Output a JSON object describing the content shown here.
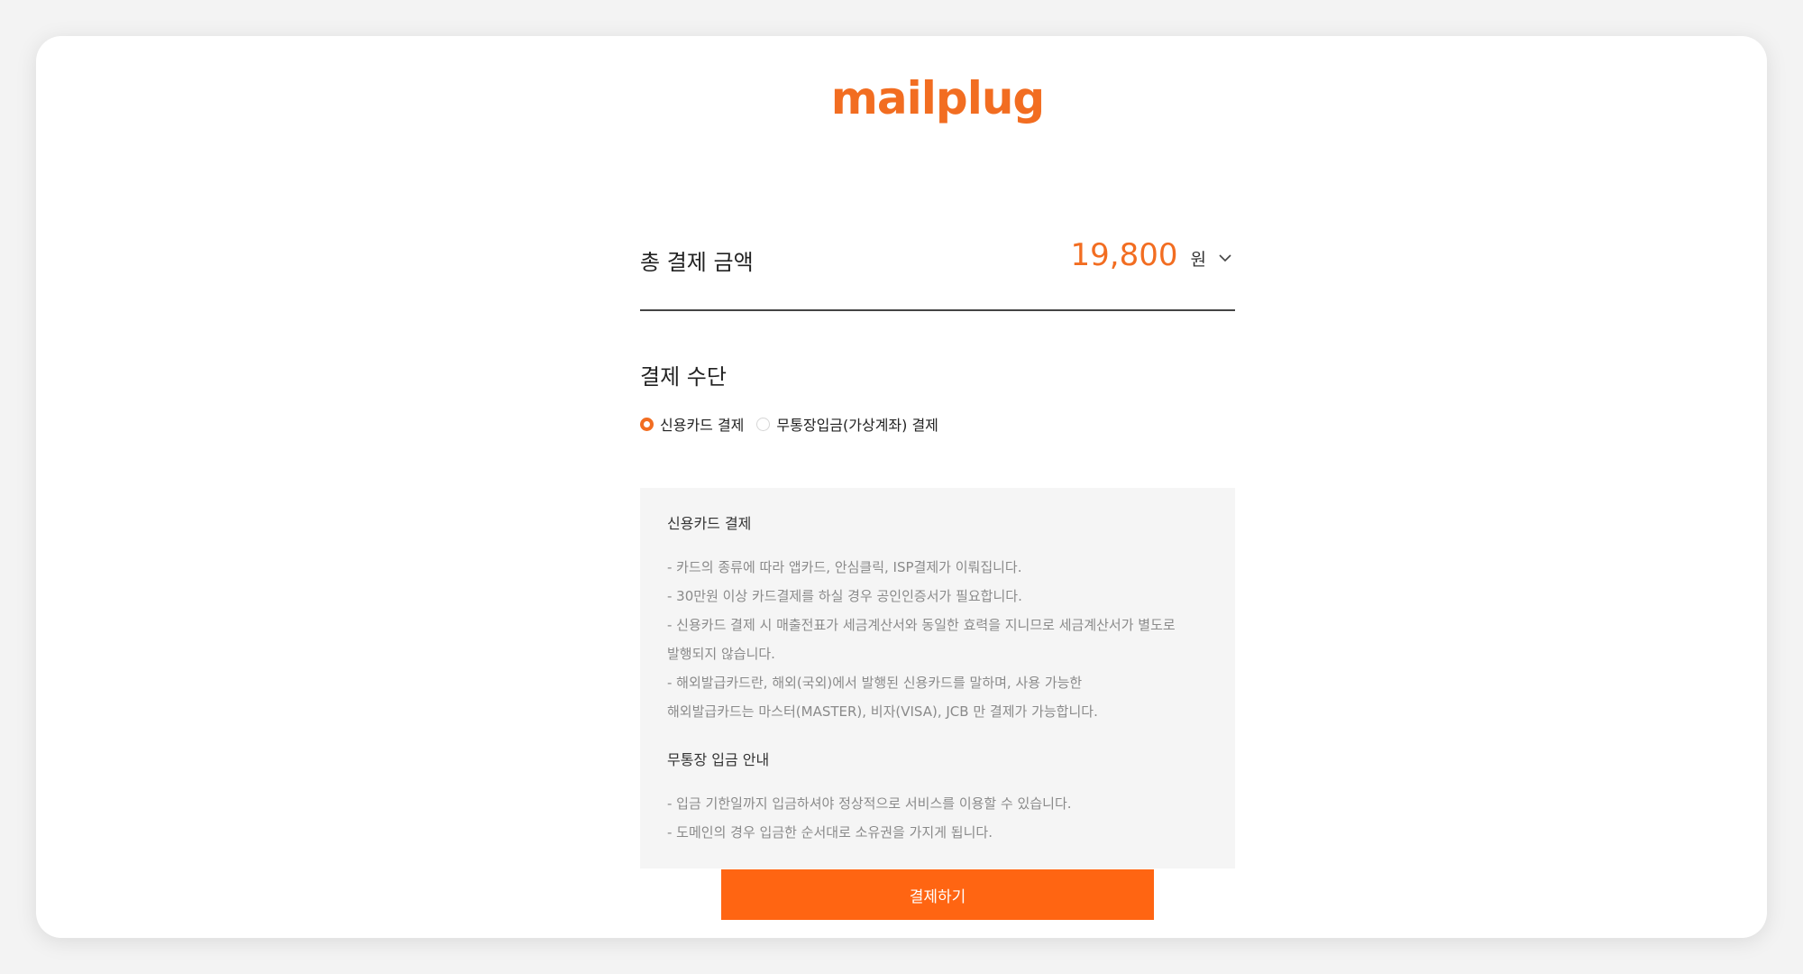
{
  "brand": {
    "logo_text": "mailplug",
    "accent": "#f26d21",
    "button_color": "#ff6512"
  },
  "total": {
    "label": "총 결제 금액",
    "amount": "19,800",
    "unit": "원",
    "toggle_icon": "chevron-down-icon"
  },
  "payment_method": {
    "title": "결제 수단",
    "options": [
      {
        "label": "신용카드 결제",
        "selected": true
      },
      {
        "label": "무통장입금(가상계좌) 결제",
        "selected": false
      }
    ]
  },
  "notice": {
    "card": {
      "heading": "신용카드 결제",
      "lines": [
        "- 카드의 종류에 따라 앱카드, 안심클릭, ISP결제가 이뤄집니다.",
        "- 30만원 이상 카드결제를 하실 경우 공인인증서가 필요합니다.",
        "- 신용카드 결제 시 매출전표가 세금계산서와 동일한 효력을 지니므로 세금계산서가 별도로",
        "발행되지 않습니다.",
        "- 해외발급카드란, 해외(국외)에서 발행된 신용카드를 말하며, 사용 가능한",
        "해외발급카드는 마스터(MASTER), 비자(VISA), JCB 만 결제가 가능합니다."
      ]
    },
    "bank": {
      "heading": "무통장 입금 안내",
      "lines": [
        "- 입금 기한일까지 입금하셔야 정상적으로 서비스를 이용할 수 있습니다.",
        "- 도메인의 경우 입금한 순서대로 소유권을 가지게 됩니다."
      ]
    }
  },
  "submit": {
    "label": "결제하기"
  }
}
